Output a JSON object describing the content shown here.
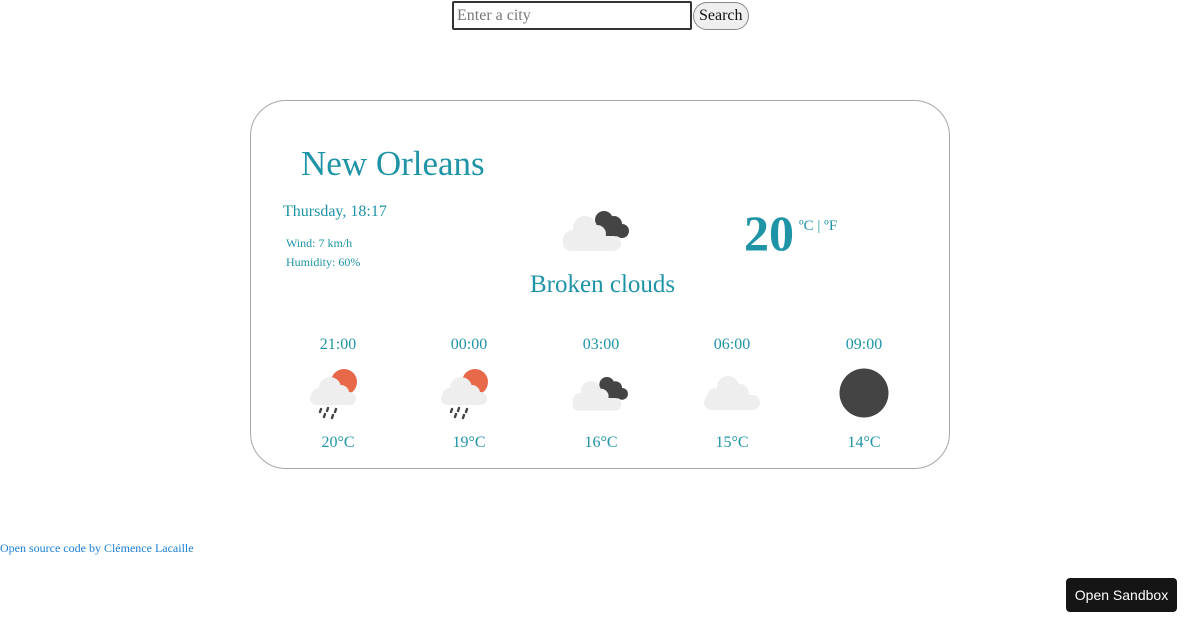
{
  "search": {
    "placeholder": "Enter a city",
    "value": "",
    "button_label": "Search"
  },
  "weather": {
    "city": "New Orleans",
    "date": "Thursday, 18:17",
    "wind": "Wind: 7 km/h",
    "humidity": "Humidity: 60%",
    "description": "Broken clouds",
    "icon": "broken-clouds-icon",
    "temperature": "20",
    "unit_celsius": "ºC",
    "unit_separator": "|",
    "unit_fahrenheit": "ºF"
  },
  "forecast": [
    {
      "time": "21:00",
      "icon": "rain-sun-icon",
      "temp": "20°C"
    },
    {
      "time": "00:00",
      "icon": "rain-sun-icon",
      "temp": "19°C"
    },
    {
      "time": "03:00",
      "icon": "broken-clouds-icon",
      "temp": "16°C"
    },
    {
      "time": "06:00",
      "icon": "cloud-icon",
      "temp": "15°C"
    },
    {
      "time": "09:00",
      "icon": "full-moon-icon",
      "temp": "14°C"
    }
  ],
  "footer": {
    "text": "Open source code by Clémence Lacaille"
  },
  "sandbox": {
    "label": "Open Sandbox"
  },
  "colors": {
    "accent": "#1f94a6",
    "link": "#1a7fd6",
    "sun": "#e8694a",
    "dark_cloud": "#444444",
    "light_cloud": "#eeeeee",
    "sandbox_bg": "#151515"
  }
}
